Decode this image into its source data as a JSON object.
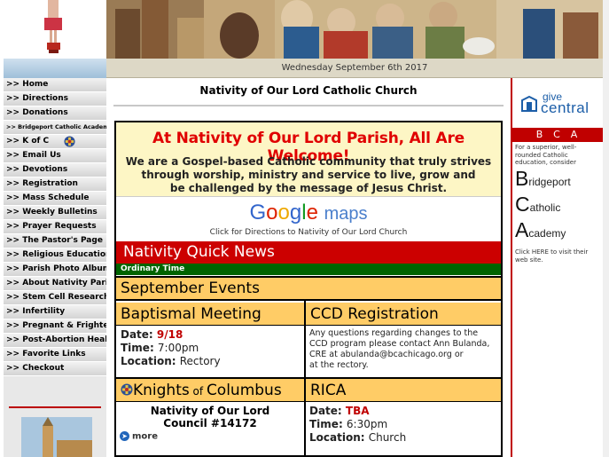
{
  "header": {
    "date": "Wednesday September 6th 2017"
  },
  "nav": {
    "items": [
      {
        "label": ">> Home",
        "small": false
      },
      {
        "label": ">> Directions",
        "small": false
      },
      {
        "label": ">> Donations",
        "small": false
      },
      {
        "label": ">> Bridgeport Catholic Academy",
        "small": true
      },
      {
        "label": ">> K of C",
        "small": false
      },
      {
        "label": ">> Email Us",
        "small": false
      },
      {
        "label": ">> Devotions",
        "small": false
      },
      {
        "label": ">> Registration",
        "small": false
      },
      {
        "label": ">> Mass Schedule",
        "small": false
      },
      {
        "label": ">> Weekly Bulletins",
        "small": false
      },
      {
        "label": ">> Prayer Requests",
        "small": false
      },
      {
        "label": ">> The Pastor's Page",
        "small": false
      },
      {
        "label": ">> Religious Education",
        "small": false
      },
      {
        "label": ">> Parish Photo Album",
        "small": false
      },
      {
        "label": ">> About Nativity Parish",
        "small": false
      },
      {
        "label": ">> Stem Cell Research",
        "small": false
      },
      {
        "label": ">> Infertility",
        "small": false
      },
      {
        "label": ">> Pregnant & Frightened",
        "small": false
      },
      {
        "label": ">> Post-Abortion Healing",
        "small": false
      },
      {
        "label": ">> Favorite Links",
        "small": false
      },
      {
        "label": ">> Checkout",
        "small": false
      }
    ]
  },
  "main": {
    "title": "Nativity of Our Lord Catholic Church",
    "welcome_heading": "At Nativity of Our Lord Parish, All Are Welcome!",
    "welcome_line1": "We are a Gospel-based Catholic community that truly strives",
    "welcome_line2": "through worship, ministry and service to live, grow and",
    "welcome_line3": "be challenged by the message of Jesus Christ.",
    "maps_caption": "Click for Directions to Nativity of Our Lord Church",
    "quick_news": "Nativity Quick News",
    "season": "Ordinary Time",
    "month_events": "September Events",
    "baptismal": {
      "heading": "Baptismal Meeting",
      "date_label": "Date: ",
      "date_value": "9/18",
      "time_label": "Time: ",
      "time_value": "7:00pm",
      "location_label": "Location: ",
      "location_value": "Rectory"
    },
    "ccd": {
      "heading": "CCD Registration",
      "line1": "Any questions regarding changes to the",
      "line2": "CCD program please contact Ann Bulanda,",
      "line3": "CRE at abulanda@bcachicago.org or",
      "line4": "at the rectory."
    },
    "kofc": {
      "heading_pre": "Knights",
      "heading_of": " of ",
      "heading_post": "Columbus",
      "line1": "Nativity of Our Lord",
      "line2": "Council #14172",
      "more": "more"
    },
    "rica": {
      "heading": "RICA",
      "date_label": "Date: ",
      "date_value": "TBA",
      "time_label": "Time: ",
      "time_value": "6:30pm",
      "location_label": "Location: ",
      "location_value": "Church"
    }
  },
  "right": {
    "give_line1": "give",
    "give_line2": "central",
    "bca": "BCA",
    "intro": "For a superior, well-rounded Catholic education, consider",
    "w1_cap": "B",
    "w1_rest": "ridgeport",
    "w2_cap": "C",
    "w2_rest": "atholic",
    "w3_cap": "A",
    "w3_rest": "cademy",
    "click": "Click HERE to visit their web site."
  },
  "colors": {
    "accent_red": "#cc0000",
    "season_green": "#006400",
    "event_gold": "#ffcc66",
    "welcome_bg": "#fdf6c5"
  }
}
